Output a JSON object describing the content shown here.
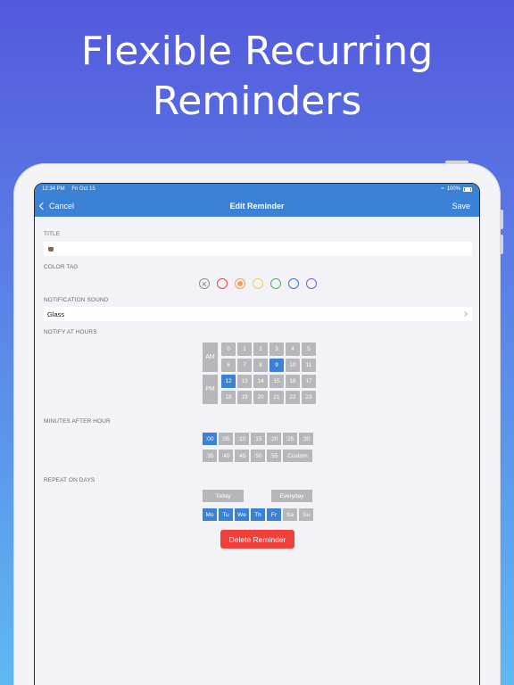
{
  "headline": {
    "line1": "Flexible Recurring",
    "line2": "Reminders"
  },
  "status_bar": {
    "time": "12:34 PM",
    "date": "Fri Oct 15",
    "battery": "100%"
  },
  "nav": {
    "cancel_label": "Cancel",
    "title": "Edit Reminder",
    "save_label": "Save"
  },
  "form": {
    "title_label": "TITLE",
    "title_value_icon": "coffee-cup-emoji",
    "color_tag_label": "COLOR TAG",
    "colors": [
      {
        "name": "none",
        "hex": "#8e8e93"
      },
      {
        "name": "red",
        "hex": "#f0453a"
      },
      {
        "name": "orange",
        "hex": "#f5a05a",
        "selected": true
      },
      {
        "name": "yellow",
        "hex": "#f3c95b"
      },
      {
        "name": "green",
        "hex": "#4cb65d"
      },
      {
        "name": "blue",
        "hex": "#3478d6"
      },
      {
        "name": "purple",
        "hex": "#8a55c8"
      }
    ],
    "sound_label": "NOTIFICATION SOUND",
    "sound_value": "Glass",
    "hours_label": "NOTIFY AT HOURS",
    "am_label": "AM",
    "pm_label": "PM",
    "am_hours": [
      "0",
      "1",
      "2",
      "3",
      "4",
      "5",
      "6",
      "7",
      "8",
      "9",
      "10",
      "11"
    ],
    "pm_hours": [
      "12",
      "13",
      "14",
      "15",
      "16",
      "17",
      "18",
      "19",
      "20",
      "21",
      "22",
      "23"
    ],
    "selected_hours": [
      "9",
      "12"
    ],
    "minutes_label": "MINUTES AFTER HOUR",
    "minutes_row1": [
      ":00",
      ":05",
      ":10",
      ":15",
      ":20",
      ":25",
      ":30"
    ],
    "minutes_row2": [
      ":35",
      ":40",
      ":45",
      ":50",
      ":55",
      "Custom"
    ],
    "selected_minutes": [
      ":00"
    ],
    "repeat_label": "REPEAT ON DAYS",
    "today_label": "Today",
    "everyday_label": "Everyday",
    "days": [
      "Mo",
      "Tu",
      "We",
      "Th",
      "Fr",
      "Sa",
      "Su"
    ],
    "selected_days": [
      "Mo",
      "Tu",
      "We",
      "Th",
      "Fr"
    ],
    "delete_label": "Delete Reminder"
  },
  "colors": {
    "accent": "#3b82d6",
    "danger": "#f13f3a",
    "cell_off": "#b7b7bb"
  }
}
